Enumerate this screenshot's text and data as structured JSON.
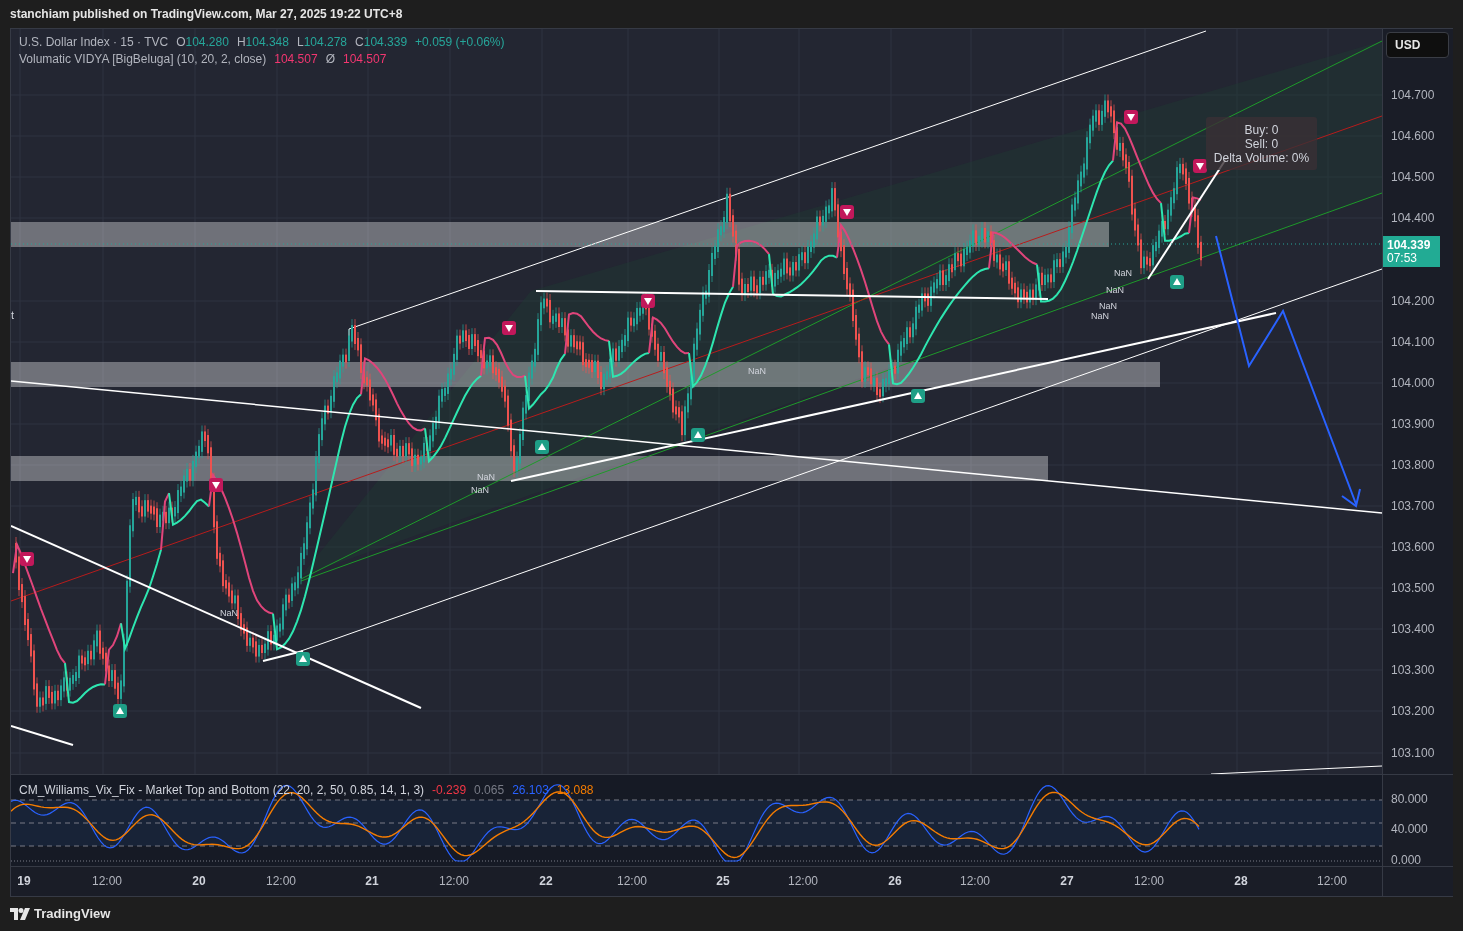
{
  "header": {
    "title": "stanchiam published on TradingView.com, Mar 27, 2025 19:22 UTC+8"
  },
  "legend": {
    "symbol": "U.S. Dollar Index · 15 · TVC",
    "ohlc": [
      {
        "label": "O",
        "value": "104.280"
      },
      {
        "label": "H",
        "value": "104.348"
      },
      {
        "label": "L",
        "value": "104.278"
      },
      {
        "label": "C",
        "value": "104.339"
      }
    ],
    "change": "+0.059 (+0.06%)",
    "indicator": "Volumatic VIDYA [BigBeluga] (10, 20, 2, close)",
    "value_1": "104.507",
    "separator": "Ø",
    "value_2": "104.507"
  },
  "edge_label": "t",
  "currency": "USD",
  "price_axis": {
    "ticks": [
      "104.700",
      "104.600",
      "104.500",
      "104.400",
      "104.200",
      "104.100",
      "104.000",
      "103.900",
      "103.800",
      "103.700",
      "103.600",
      "103.500",
      "103.400",
      "103.300",
      "103.200",
      "103.100"
    ],
    "last_price": "104.339",
    "countdown": "07:53"
  },
  "stats_box": [
    "Buy: 0",
    "Sell: 0",
    "Delta Volume: 0%"
  ],
  "nan_labels": [
    "NaN",
    "NaN",
    "NaN",
    "NaN",
    "NaN",
    "NaN",
    "NaN",
    "NaN"
  ],
  "oscillator": {
    "title": "CM_Williams_Vix_Fix - Market Top and Bottom (22, 20, 2, 50, 0.85, 14, 1, 3)",
    "values": [
      {
        "text": "-0.239",
        "color": "#f23645"
      },
      {
        "text": "0.065",
        "color": "#787b86"
      },
      {
        "text": "26.103",
        "color": "#2962ff"
      },
      {
        "text": "13.088",
        "color": "#f57c00"
      }
    ],
    "ticks": [
      "80.000",
      "40.000",
      "0.000"
    ]
  },
  "time_axis": [
    {
      "text": "19",
      "kind": "day"
    },
    {
      "text": "12:00",
      "kind": "time"
    },
    {
      "text": "20",
      "kind": "day"
    },
    {
      "text": "12:00",
      "kind": "time"
    },
    {
      "text": "21",
      "kind": "day"
    },
    {
      "text": "12:00",
      "kind": "time"
    },
    {
      "text": "22",
      "kind": "day"
    },
    {
      "text": "12:00",
      "kind": "time"
    },
    {
      "text": "25",
      "kind": "day"
    },
    {
      "text": "12:00",
      "kind": "time"
    },
    {
      "text": "26",
      "kind": "day"
    },
    {
      "text": "12:00",
      "kind": "time"
    },
    {
      "text": "27",
      "kind": "day"
    },
    {
      "text": "12:00",
      "kind": "time"
    },
    {
      "text": "28",
      "kind": "day"
    },
    {
      "text": "12:00",
      "kind": "time"
    }
  ],
  "footer": {
    "brand": "TradingView"
  }
}
